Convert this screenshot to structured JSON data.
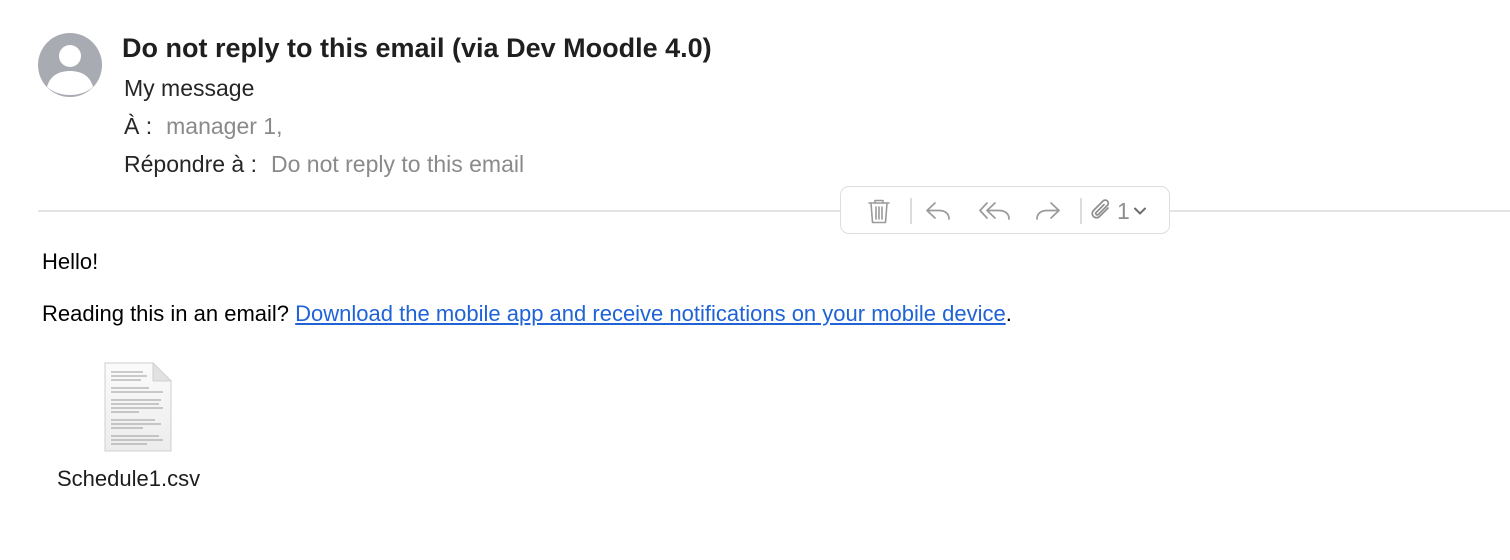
{
  "header": {
    "subject": "Do not reply to this email (via Dev Moodle 4.0)",
    "message_title": "My message",
    "to_label": "À :",
    "to_value": "manager 1,",
    "reply_to_label": "Répondre à :",
    "reply_to_value": "Do not reply to this email"
  },
  "toolbar": {
    "buttons": [
      {
        "name": "trash",
        "icon": "trash-icon"
      },
      {
        "name": "reply",
        "icon": "reply-icon"
      },
      {
        "name": "reply-all",
        "icon": "reply-all-icon"
      },
      {
        "name": "forward",
        "icon": "forward-icon"
      },
      {
        "name": "attachments",
        "icon": "paperclip-icon"
      }
    ],
    "attachment_count": "1"
  },
  "body": {
    "greeting": "Hello!",
    "reading_prefix": "Reading this in an email?",
    "link_text": "Download the mobile app and receive notifications on your mobile device",
    "reading_suffix": "."
  },
  "attachment": {
    "filename": "Schedule1.csv",
    "icon": "document-icon"
  },
  "colors": {
    "link": "#1f63d6",
    "muted": "#8a8a8a",
    "avatar": "#a9abb2",
    "toolbar_icon": "#9a9a9a"
  }
}
